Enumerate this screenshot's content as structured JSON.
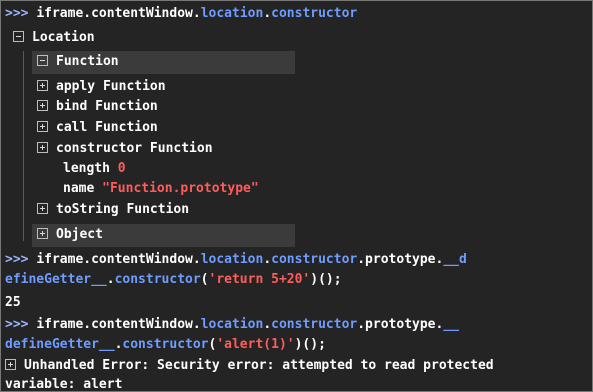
{
  "console": {
    "cmd1": {
      "prompt": ">>>",
      "obj": "iframe.contentWindow.",
      "loc": "location",
      "dot": ".",
      "ctor": "constructor"
    },
    "tree": {
      "location_label": "Location",
      "function_label": "Function",
      "items": [
        {
          "label": "apply Function"
        },
        {
          "label": "bind Function"
        },
        {
          "label": "call Function"
        },
        {
          "label": "constructor Function"
        }
      ],
      "length_key": "length",
      "length_val": "0",
      "name_key": "name",
      "name_val": "\"Function.prototype\"",
      "tostring_label": "toString Function",
      "object_label": "Object"
    },
    "cmd2": {
      "prompt": ">>>",
      "a": "iframe.contentWindow.",
      "loc": "location",
      "dot1": ".",
      "ctor": "constructor",
      "b": ".prototype.",
      "dg1": "__d",
      "dg2": "efineGetter__",
      "dot2": ".",
      "ctor2": "constructor",
      "p1": "(",
      "str": "'return 5+20'",
      "p2": ")();"
    },
    "result2": "25",
    "cmd3": {
      "prompt": ">>>",
      "a": "iframe.contentWindow.",
      "loc": "location",
      "dot1": ".",
      "ctor": "constructor",
      "b": ".prototype.",
      "dg1": "__",
      "dg2": "defineGetter__",
      "dot2": ".",
      "ctor2": "constructor",
      "p1": "(",
      "str": "'alert(1)'",
      "p2": ")();"
    },
    "error": {
      "line1": "Unhandled Error: Security error: attempted to read protected",
      "line2": "variable: alert"
    }
  }
}
